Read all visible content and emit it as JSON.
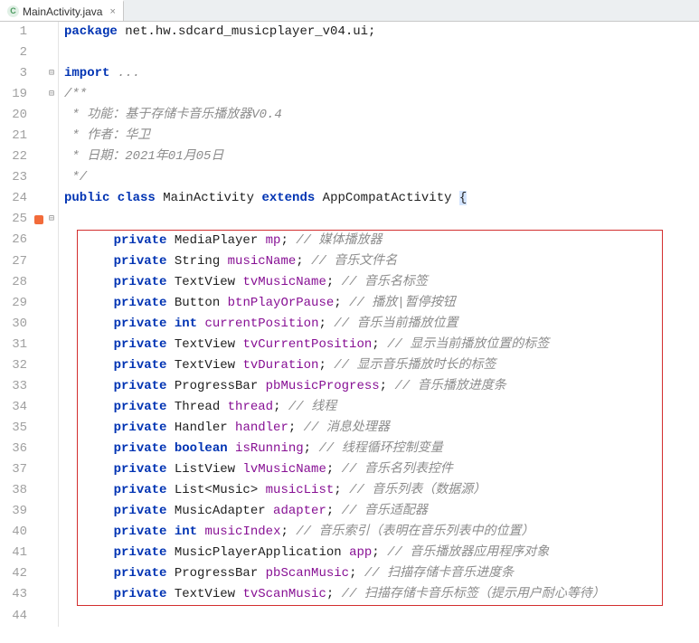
{
  "tab": {
    "filename": "MainActivity.java",
    "icon_letter": "C"
  },
  "gutter": {
    "bookmark_line": 25,
    "fold_minus_lines": [
      3,
      19,
      25
    ],
    "fold_plus_lines": [],
    "modified_lines": [
      25
    ]
  },
  "code_lines": [
    {
      "num": 1,
      "tokens": [
        [
          "kw",
          "package"
        ],
        [
          "",
          " net.hw.sdcard_musicplayer_v04.ui;"
        ]
      ]
    },
    {
      "num": 2,
      "tokens": [
        [
          "",
          ""
        ]
      ]
    },
    {
      "num": 3,
      "tokens": [
        [
          "kw",
          "import"
        ],
        [
          "",
          " "
        ],
        [
          "fold-txt",
          "..."
        ]
      ]
    },
    {
      "num": 19,
      "tokens": [
        [
          "doc",
          "/**"
        ]
      ]
    },
    {
      "num": 20,
      "tokens": [
        [
          "doc",
          " * 功能：基于存储卡音乐播放器V0.4"
        ]
      ]
    },
    {
      "num": 21,
      "tokens": [
        [
          "doc",
          " * 作者：华卫"
        ]
      ]
    },
    {
      "num": 22,
      "tokens": [
        [
          "doc",
          " * 日期：2021年01月05日"
        ]
      ]
    },
    {
      "num": 23,
      "tokens": [
        [
          "doc",
          " */"
        ]
      ]
    },
    {
      "num": 24,
      "tokens": [
        [
          "kw",
          "public class"
        ],
        [
          "",
          " MainActivity "
        ],
        [
          "kw",
          "extends"
        ],
        [
          "",
          " AppCompatActivity "
        ],
        [
          "hl",
          "{"
        ]
      ]
    },
    {
      "num": 25,
      "tokens": [
        [
          "",
          ""
        ]
      ]
    },
    {
      "num": 26,
      "box_start": true,
      "tokens": [
        [
          "",
          "    "
        ],
        [
          "kw",
          "private"
        ],
        [
          "",
          " MediaPlayer "
        ],
        [
          "field",
          "mp"
        ],
        [
          "",
          "; "
        ],
        [
          "cmt",
          "// 媒体播放器"
        ]
      ]
    },
    {
      "num": 27,
      "tokens": [
        [
          "",
          "    "
        ],
        [
          "kw",
          "private"
        ],
        [
          "",
          " String "
        ],
        [
          "field",
          "musicName"
        ],
        [
          "",
          "; "
        ],
        [
          "cmt",
          "// 音乐文件名"
        ]
      ]
    },
    {
      "num": 28,
      "tokens": [
        [
          "",
          "    "
        ],
        [
          "kw",
          "private"
        ],
        [
          "",
          " TextView "
        ],
        [
          "field",
          "tvMusicName"
        ],
        [
          "",
          "; "
        ],
        [
          "cmt",
          "// 音乐名标签"
        ]
      ]
    },
    {
      "num": 29,
      "tokens": [
        [
          "",
          "    "
        ],
        [
          "kw",
          "private"
        ],
        [
          "",
          " Button "
        ],
        [
          "field",
          "btnPlayOrPause"
        ],
        [
          "",
          "; "
        ],
        [
          "cmt",
          "// 播放|暂停按钮"
        ]
      ]
    },
    {
      "num": 30,
      "tokens": [
        [
          "",
          "    "
        ],
        [
          "kw",
          "private"
        ],
        [
          "",
          " "
        ],
        [
          "kw",
          "int"
        ],
        [
          "",
          " "
        ],
        [
          "field",
          "currentPosition"
        ],
        [
          "",
          "; "
        ],
        [
          "cmt",
          "// 音乐当前播放位置"
        ]
      ]
    },
    {
      "num": 31,
      "tokens": [
        [
          "",
          "    "
        ],
        [
          "kw",
          "private"
        ],
        [
          "",
          " TextView "
        ],
        [
          "field",
          "tvCurrentPosition"
        ],
        [
          "",
          "; "
        ],
        [
          "cmt",
          "// 显示当前播放位置的标签"
        ]
      ]
    },
    {
      "num": 32,
      "tokens": [
        [
          "",
          "    "
        ],
        [
          "kw",
          "private"
        ],
        [
          "",
          " TextView "
        ],
        [
          "field",
          "tvDuration"
        ],
        [
          "",
          "; "
        ],
        [
          "cmt",
          "// 显示音乐播放时长的标签"
        ]
      ]
    },
    {
      "num": 33,
      "tokens": [
        [
          "",
          "    "
        ],
        [
          "kw",
          "private"
        ],
        [
          "",
          " ProgressBar "
        ],
        [
          "field",
          "pbMusicProgress"
        ],
        [
          "",
          "; "
        ],
        [
          "cmt",
          "// 音乐播放进度条"
        ]
      ]
    },
    {
      "num": 34,
      "tokens": [
        [
          "",
          "    "
        ],
        [
          "kw",
          "private"
        ],
        [
          "",
          " Thread "
        ],
        [
          "field",
          "thread"
        ],
        [
          "",
          "; "
        ],
        [
          "cmt",
          "// 线程"
        ]
      ]
    },
    {
      "num": 35,
      "tokens": [
        [
          "",
          "    "
        ],
        [
          "kw",
          "private"
        ],
        [
          "",
          " Handler "
        ],
        [
          "field",
          "handler"
        ],
        [
          "",
          "; "
        ],
        [
          "cmt",
          "// 消息处理器"
        ]
      ]
    },
    {
      "num": 36,
      "tokens": [
        [
          "",
          "    "
        ],
        [
          "kw",
          "private"
        ],
        [
          "",
          " "
        ],
        [
          "kw",
          "boolean"
        ],
        [
          "",
          " "
        ],
        [
          "field",
          "isRunning"
        ],
        [
          "",
          "; "
        ],
        [
          "cmt",
          "// 线程循环控制变量"
        ]
      ]
    },
    {
      "num": 37,
      "tokens": [
        [
          "",
          "    "
        ],
        [
          "kw",
          "private"
        ],
        [
          "",
          " ListView "
        ],
        [
          "field",
          "lvMusicName"
        ],
        [
          "",
          "; "
        ],
        [
          "cmt",
          "// 音乐名列表控件"
        ]
      ]
    },
    {
      "num": 38,
      "tokens": [
        [
          "",
          "    "
        ],
        [
          "kw",
          "private"
        ],
        [
          "",
          " List<Music> "
        ],
        [
          "field",
          "musicList"
        ],
        [
          "",
          "; "
        ],
        [
          "cmt",
          "// 音乐列表（数据源）"
        ]
      ]
    },
    {
      "num": 39,
      "tokens": [
        [
          "",
          "    "
        ],
        [
          "kw",
          "private"
        ],
        [
          "",
          " MusicAdapter "
        ],
        [
          "field",
          "adapter"
        ],
        [
          "",
          "; "
        ],
        [
          "cmt",
          "// 音乐适配器"
        ]
      ]
    },
    {
      "num": 40,
      "tokens": [
        [
          "",
          "    "
        ],
        [
          "kw",
          "private"
        ],
        [
          "",
          " "
        ],
        [
          "kw",
          "int"
        ],
        [
          "",
          " "
        ],
        [
          "field",
          "musicIndex"
        ],
        [
          "",
          "; "
        ],
        [
          "cmt",
          "// 音乐索引（表明在音乐列表中的位置）"
        ]
      ]
    },
    {
      "num": 41,
      "tokens": [
        [
          "",
          "    "
        ],
        [
          "kw",
          "private"
        ],
        [
          "",
          " MusicPlayerApplication "
        ],
        [
          "field",
          "app"
        ],
        [
          "",
          "; "
        ],
        [
          "cmt",
          "// 音乐播放器应用程序对象"
        ]
      ]
    },
    {
      "num": 42,
      "tokens": [
        [
          "",
          "    "
        ],
        [
          "kw",
          "private"
        ],
        [
          "",
          " ProgressBar "
        ],
        [
          "field",
          "pbScanMusic"
        ],
        [
          "",
          "; "
        ],
        [
          "cmt",
          "// 扫描存储卡音乐进度条"
        ]
      ]
    },
    {
      "num": 43,
      "box_end": true,
      "tokens": [
        [
          "",
          "    "
        ],
        [
          "kw",
          "private"
        ],
        [
          "",
          " TextView "
        ],
        [
          "field",
          "tvScanMusic"
        ],
        [
          "",
          "; "
        ],
        [
          "cmt",
          "// 扫描存储卡音乐标签（提示用户耐心等待）"
        ]
      ]
    },
    {
      "num": 44,
      "tokens": [
        [
          "",
          ""
        ]
      ]
    }
  ],
  "display_nums": [
    1,
    2,
    3,
    19,
    20,
    21,
    22,
    23,
    24,
    25,
    26,
    27,
    28,
    29,
    30,
    31,
    32,
    33,
    34,
    35,
    36,
    37,
    38,
    39,
    40,
    41,
    42,
    43,
    44
  ]
}
